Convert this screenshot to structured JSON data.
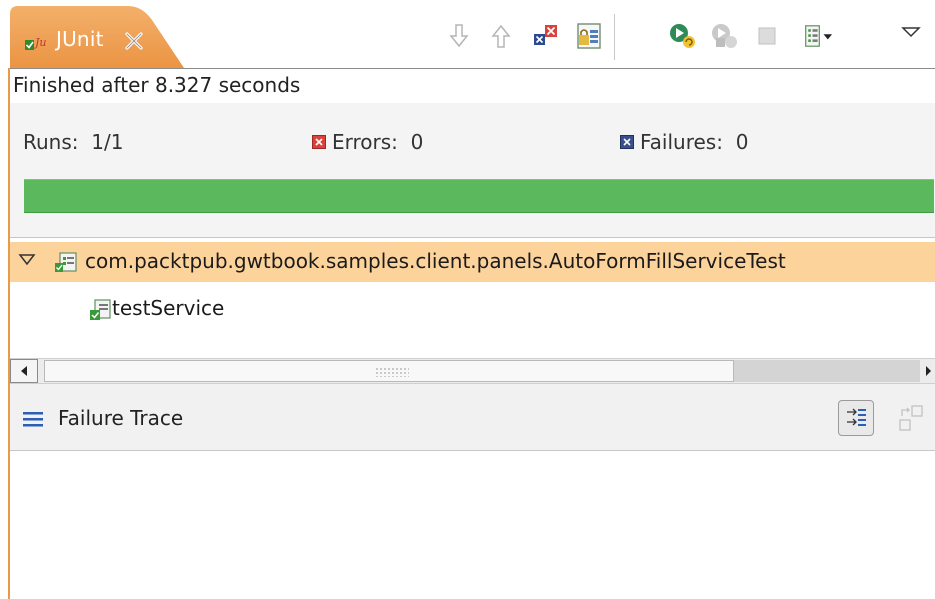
{
  "tab": {
    "title": "JUnit",
    "close_icon": "close-icon"
  },
  "toolbar": {
    "buttons": [
      {
        "name": "next-failure-button",
        "icon": "arrow-down-icon"
      },
      {
        "name": "previous-failure-button",
        "icon": "arrow-up-icon"
      },
      {
        "name": "show-failures-only-button",
        "icon": "failures-filter-icon"
      },
      {
        "name": "scroll-lock-button",
        "icon": "scroll-lock-icon"
      },
      {
        "name": "rerun-test-button",
        "icon": "rerun-icon"
      },
      {
        "name": "rerun-failed-first-button",
        "icon": "rerun-failed-icon"
      },
      {
        "name": "stop-button",
        "icon": "stop-icon"
      },
      {
        "name": "test-run-history-button",
        "icon": "history-icon"
      },
      {
        "name": "view-menu-button",
        "icon": "view-menu-icon"
      }
    ]
  },
  "status": {
    "text": "Finished after 8.327 seconds"
  },
  "counters": {
    "runs_label": "Runs:",
    "runs_value": "1/1",
    "errors_label": "Errors:",
    "errors_value": "0",
    "failures_label": "Failures:",
    "failures_value": "0"
  },
  "progress": {
    "fraction": 1.0,
    "color": "#5cb85c"
  },
  "tree": {
    "suite": {
      "label": "com.packtpub.gwtbook.samples.client.panels.AutoFormFillServiceTest",
      "icon": "test-suite-icon",
      "expanded": true
    },
    "tests": [
      {
        "label": "testService",
        "icon": "test-passed-icon"
      }
    ]
  },
  "failure_trace": {
    "title": "Failure Trace",
    "icon": "list-icon"
  },
  "colors": {
    "tab_orange": "#f0a050",
    "selection": "#fdd39c",
    "error_red": "#d9423a",
    "failure_blue": "#3b4f8a"
  }
}
